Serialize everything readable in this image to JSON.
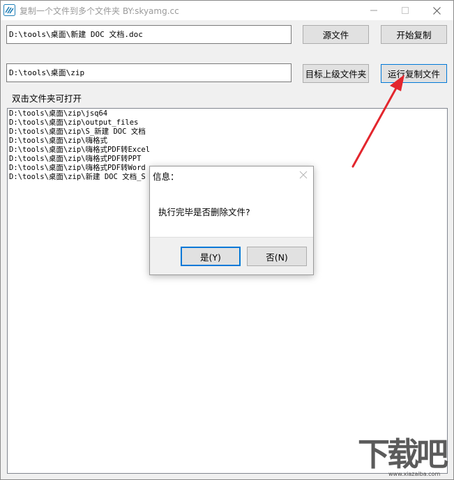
{
  "window": {
    "title": "复制一个文件到多个文件夹  BY:skyamg.cc",
    "minimize_glyph": "—",
    "maximize_glyph": "☐",
    "close_glyph": "✕"
  },
  "source": {
    "path": "D:\\tools\\桌面\\新建 DOC 文档.doc",
    "source_button_label": "源文件",
    "start_copy_button_label": "开始复制"
  },
  "target": {
    "path": "D:\\tools\\桌面\\zip",
    "parent_folder_button_label": "目标上级文件夹",
    "run_copy_button_label": "运行复制文件"
  },
  "folder_list": {
    "label": "双击文件夹可打开",
    "items": [
      "D:\\tools\\桌面\\zip\\jsq64",
      "D:\\tools\\桌面\\zip\\output_files",
      "D:\\tools\\桌面\\zip\\S_新建 DOC 文档",
      "D:\\tools\\桌面\\zip\\嗨格式",
      "D:\\tools\\桌面\\zip\\嗨格式PDF转Excel",
      "D:\\tools\\桌面\\zip\\嗨格式PDF转PPT",
      "D:\\tools\\桌面\\zip\\嗨格式PDF转Word",
      "D:\\tools\\桌面\\zip\\新建 DOC 文档_S"
    ]
  },
  "dialog": {
    "title": "信息：",
    "message": "执行完毕是否删除文件?",
    "yes_label": "是(Y)",
    "no_label": "否(N)"
  },
  "watermark": {
    "text": "下载吧",
    "sub_text": "www.xiazaiba.com"
  },
  "colors": {
    "accent": "#0078d7",
    "arrow": "#e3262d",
    "window_bg": "#f0f0f0"
  }
}
